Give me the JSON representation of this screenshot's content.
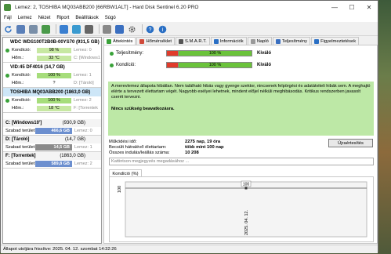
{
  "window": {
    "title": "Lemez: 2, TOSHIBA MQ03ABB200 [66RBW1ALT]  -  Hard Disk Sentinel 6.20 PRO",
    "controls": [
      "—",
      "☐",
      "✕"
    ]
  },
  "menu": [
    "Fájl",
    "Lemez",
    "Nézet",
    "Riport",
    "Beállítások",
    "Súgó"
  ],
  "disks": [
    {
      "name": "WDC WDS100T2B0B-00YS70",
      "size": "(931,5 GB)",
      "health_label": "Kondíció:",
      "health": "98 %",
      "health_value": 98,
      "health_extra": "Lemez: 0",
      "temp_label": "Hőm.:",
      "temp": "33 °C",
      "temp_extra": "C: [Windows1"
    },
    {
      "name": "VID:45 DF4016",
      "size": "(14,7 GB)",
      "health_label": "Kondíció:",
      "health": "100 %",
      "health_value": 100,
      "health_extra": "Lemez: 1",
      "temp_label": "Hőm.:",
      "temp": "?",
      "temp_extra": "D: [Tároló]"
    },
    {
      "name": "TOSHIBA MQ03ABB200",
      "size": "(1863,0 GB)",
      "health_label": "Kondíció:",
      "health": "100 %",
      "health_value": 100,
      "health_extra": "Lemez: 2",
      "temp_label": "Hőm.:",
      "temp": "18 °C",
      "temp_extra": "F: [Torrentek"
    }
  ],
  "volumes": [
    {
      "name": "C: [Windows10']",
      "size": "(930,9 GB)",
      "free_label": "Szabad terület",
      "free": "466,6 GB",
      "disk": "Lemez: 0",
      "color": "blue"
    },
    {
      "name": "D: [Tároló]",
      "size": "(14,7 GB)",
      "free_label": "Szabad terület",
      "free": "14,5 GB",
      "disk": "Lemez: 1",
      "color": "gray"
    },
    {
      "name": "F: [Torrentek]",
      "size": "(1863,0 GB)",
      "free_label": "Szabad terület",
      "free": "589,8 GB",
      "disk": "Lemez: 2",
      "color": "blue"
    }
  ],
  "tabs": [
    "Áttekintés",
    "Hőmérséklet",
    "S.M.A.R.T.",
    "Információk",
    "Napló",
    "Teljesítmény",
    "Figyelmeztetések"
  ],
  "overview": {
    "performance_label": "Teljesítmény:",
    "performance": "100 %",
    "performance_value": 100,
    "performance_status": "Kiváló",
    "health_label": "Kondíció:",
    "health": "100 %",
    "health_value": 100,
    "health_status": "Kiváló",
    "message": "A merevlemez állapota hibátlan. Nem található hibás vagy gyenge szektor, nincsenek felpörgési és adatátviteli hibák sem. A meghajtó elérte a tervezett élettartam végét. Nagyobb esélyei lehetnek, mindent előjel nélküli meghibásodás. Kritikus rendszerben javasolt cserét tervezni.",
    "message_action": "Nincs szükség beavatkozásra.",
    "stats": [
      {
        "label": "Működési idő:",
        "value": "2275 nap, 19 óra"
      },
      {
        "label": "Becsült hátralévő élettartam:",
        "value": "több mint 100 nap"
      },
      {
        "label": "Összes indulás/leállás száma:",
        "value": "10 208"
      }
    ],
    "notify_button": "Újraértesítés",
    "comment_placeholder": "Kattintson megjegyzés megadásához ..."
  },
  "chart_tab": "Kondíció  (%)",
  "chart_data": {
    "type": "line",
    "x": [
      "2025. 04. 12."
    ],
    "values": [
      100
    ],
    "ylabel_tick": "100",
    "point_label": "100"
  },
  "statusbar": "Állapot utoljára frissítve: 2025. 04. 12. szombat 14:32:26"
}
